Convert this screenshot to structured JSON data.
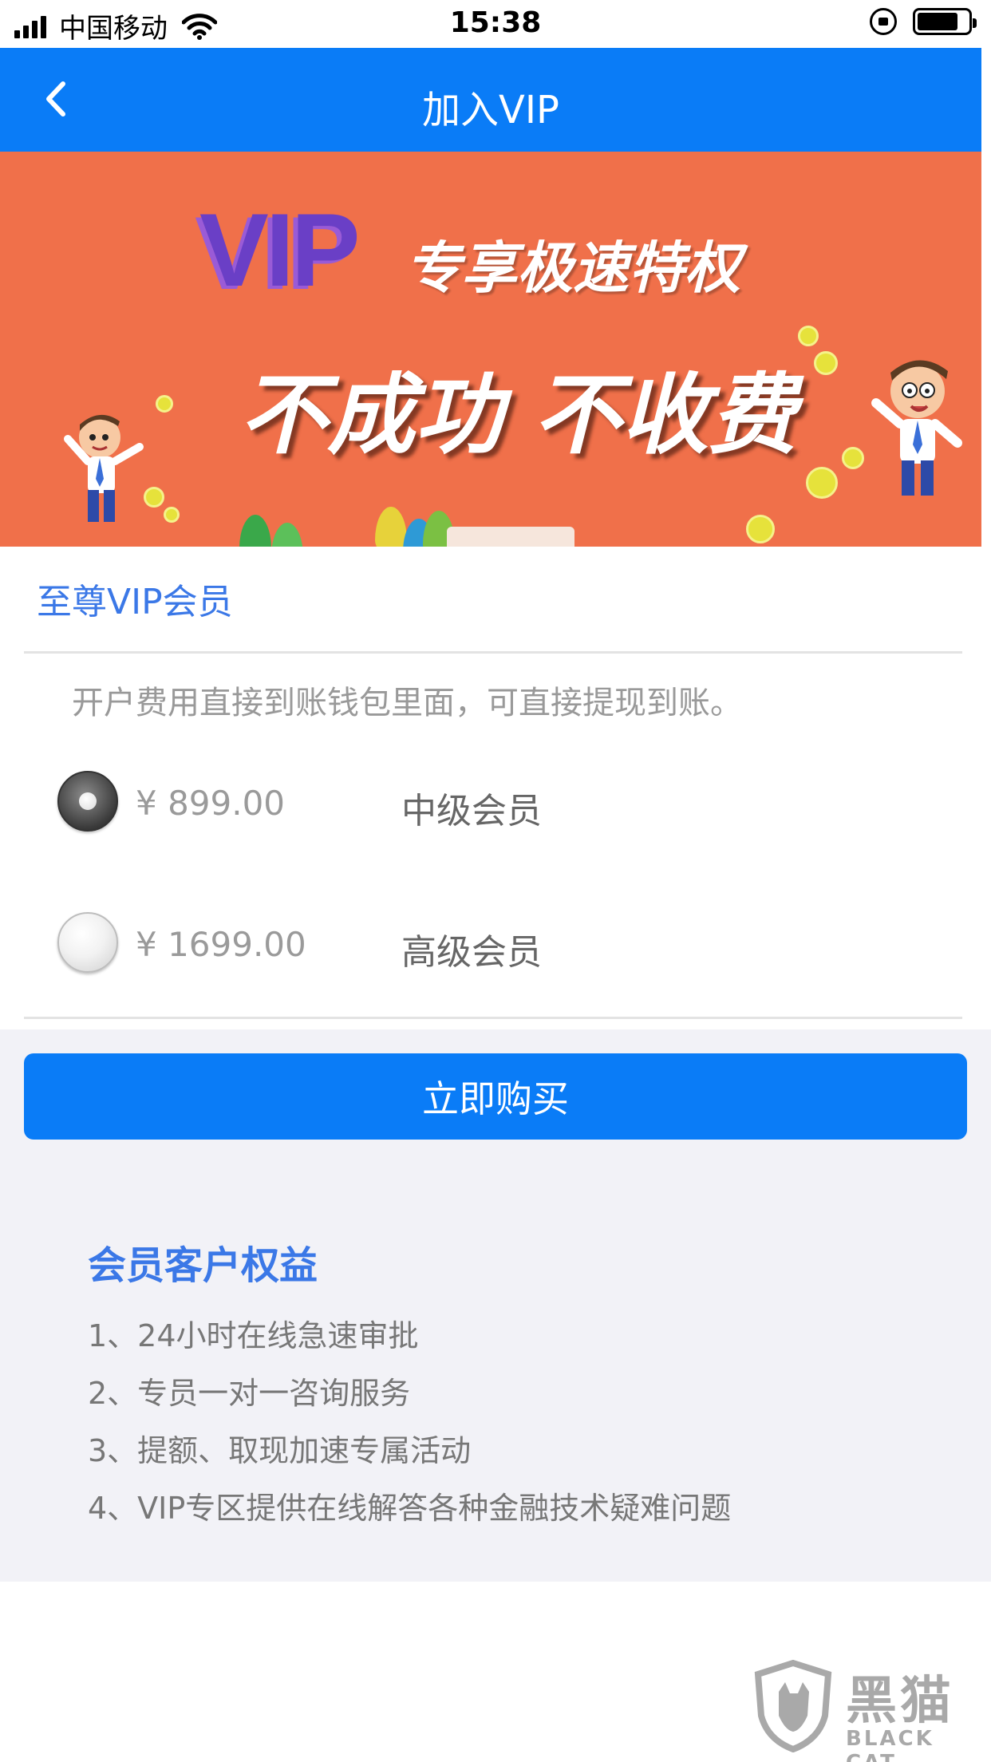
{
  "status_bar": {
    "carrier": "中国移动",
    "time": "15:38"
  },
  "nav": {
    "title": "加入VIP",
    "back_icon": "chevron-left-icon"
  },
  "banner": {
    "vip_text": "VIP",
    "tagline": "专享极速特权",
    "slogan": "不成功 不收费",
    "background_color": "#f0704a"
  },
  "membership": {
    "title": "至尊VIP会员",
    "notice": "开户费用直接到账钱包里面，可直接提现到账。",
    "options": [
      {
        "price": "¥  899.00",
        "level": "中级会员",
        "selected": true
      },
      {
        "price": "¥  1699.00",
        "level": "高级会员",
        "selected": false
      }
    ]
  },
  "buy_button": {
    "label": "立即购买",
    "color": "#0a7cf7"
  },
  "benefits": {
    "title": "会员客户权益",
    "items": [
      "1、24小时在线急速审批",
      "2、专员一对一咨询服务",
      "3、提额、取现加速专属活动",
      "4、VIP专区提供在线解答各种金融技术疑难问题"
    ]
  },
  "watermark": {
    "text": "黑猫",
    "sub": "BLACK CAT"
  },
  "colors": {
    "accent": "#0a7cf7",
    "title_blue": "#3b78e7",
    "grey_bg": "#f2f2f7"
  }
}
